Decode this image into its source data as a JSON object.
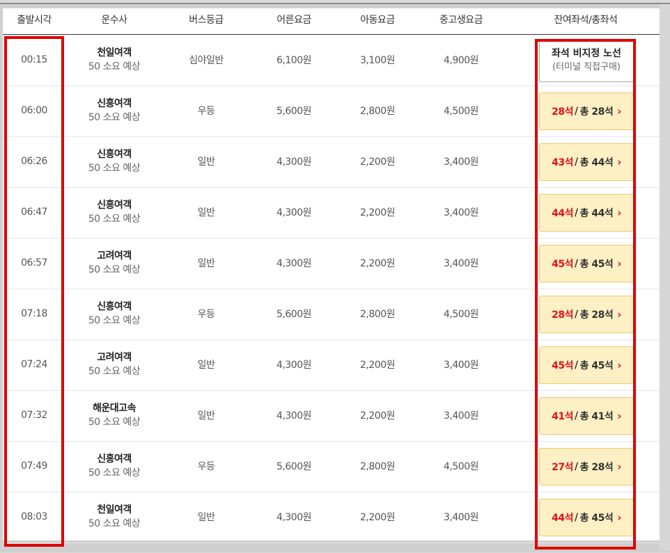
{
  "headers": {
    "depart_time": "출발시각",
    "company": "운수사",
    "grade": "버스등급",
    "adult": "어른요금",
    "child": "아동요금",
    "teen": "중고생요금",
    "seats": "잔여좌석/총좌석"
  },
  "rows": [
    {
      "time": "00:15",
      "company": "천일여객",
      "duration": "50 소요 예상",
      "grade": "심야일반",
      "adult": "6,100원",
      "child": "3,100원",
      "teen": "4,900원",
      "seat_unavailable": true,
      "na_line1": "좌석 비지정 노선",
      "na_line2": "(터미널 직접구매)"
    },
    {
      "time": "06:00",
      "company": "신흥여객",
      "duration": "50 소요 예상",
      "grade": "우등",
      "adult": "5,600원",
      "child": "2,800원",
      "teen": "4,500원",
      "remain": "28석",
      "total": "총 28석"
    },
    {
      "time": "06:26",
      "company": "신흥여객",
      "duration": "50 소요 예상",
      "grade": "일반",
      "adult": "4,300원",
      "child": "2,200원",
      "teen": "3,400원",
      "remain": "43석",
      "total": "총 44석"
    },
    {
      "time": "06:47",
      "company": "신흥여객",
      "duration": "50 소요 예상",
      "grade": "일반",
      "adult": "4,300원",
      "child": "2,200원",
      "teen": "3,400원",
      "remain": "44석",
      "total": "총 44석"
    },
    {
      "time": "06:57",
      "company": "고려여객",
      "duration": "50 소요 예상",
      "grade": "일반",
      "adult": "4,300원",
      "child": "2,200원",
      "teen": "3,400원",
      "remain": "45석",
      "total": "총 45석"
    },
    {
      "time": "07:18",
      "company": "신흥여객",
      "duration": "50 소요 예상",
      "grade": "우등",
      "adult": "5,600원",
      "child": "2,800원",
      "teen": "4,500원",
      "remain": "28석",
      "total": "총 28석"
    },
    {
      "time": "07:24",
      "company": "고려여객",
      "duration": "50 소요 예상",
      "grade": "일반",
      "adult": "4,300원",
      "child": "2,200원",
      "teen": "3,400원",
      "remain": "45석",
      "total": "총 45석"
    },
    {
      "time": "07:32",
      "company": "해운대고속",
      "duration": "50 소요 예상",
      "grade": "일반",
      "adult": "4,300원",
      "child": "2,200원",
      "teen": "3,400원",
      "remain": "41석",
      "total": "총 41석"
    },
    {
      "time": "07:49",
      "company": "신흥여객",
      "duration": "50 소요 예상",
      "grade": "우등",
      "adult": "5,600원",
      "child": "2,800원",
      "teen": "4,500원",
      "remain": "27석",
      "total": "총 28석"
    },
    {
      "time": "08:03",
      "company": "천일여객",
      "duration": "50 소요 예상",
      "grade": "일반",
      "adult": "4,300원",
      "child": "2,200원",
      "teen": "3,400원",
      "remain": "44석",
      "total": "총 45석"
    }
  ],
  "seat_sep": "/",
  "chevron": "›",
  "colors": {
    "highlight": "#e00000",
    "remain": "#e0101b",
    "seat_bg": "#fdf0c4",
    "seat_border": "#f2c56a"
  }
}
